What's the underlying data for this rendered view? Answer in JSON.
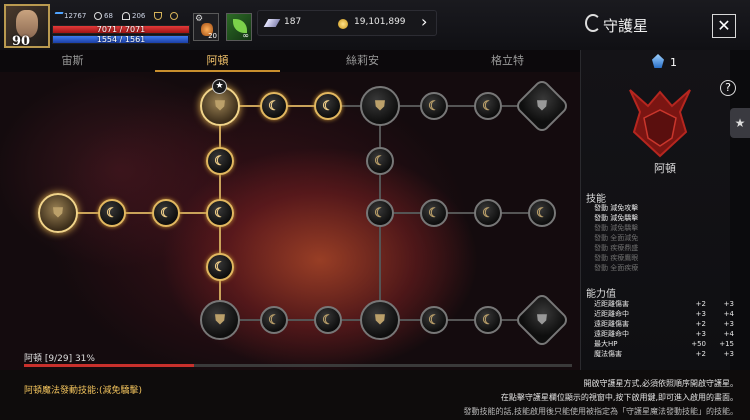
{
  "player": {
    "level": "90",
    "stat_a": "12767",
    "stat_b": "68",
    "stat_c": "206",
    "hp": "7071 / 7071",
    "mp": "1554 / 1561",
    "hp_fraction": 1.0,
    "mp_fraction": 0.9955
  },
  "top_items": {
    "potion_count": "20",
    "elixir_label": "∞"
  },
  "currency": {
    "gems": "187",
    "gold": "19,101,899",
    "arrow": "›"
  },
  "header": {
    "title": "守護星",
    "close": "✕"
  },
  "tabs": [
    {
      "label": "宙斯",
      "active": false
    },
    {
      "label": "阿頓",
      "active": true
    },
    {
      "label": "絲莉安",
      "active": false
    },
    {
      "label": "格立特",
      "active": false
    }
  ],
  "map": {
    "glyph_small": "☾",
    "glyph_big": "⛊",
    "star": "★"
  },
  "progress": {
    "label": "阿頓 [9/29] 31%",
    "fraction": 0.31
  },
  "panel": {
    "gem_count": "1",
    "crest_name": "阿頓",
    "help": "?",
    "side_tab": "★",
    "skills_title": "技能",
    "skills": [
      {
        "text": "發動 減免攻擊",
        "active": true
      },
      {
        "text": "發動 減免驕擊",
        "active": true
      },
      {
        "text": "發動 減免驕擊",
        "active": false
      },
      {
        "text": "發動 全面減免",
        "active": false
      },
      {
        "text": "發動 疾療鼎盛",
        "active": false
      },
      {
        "text": "發動 疾療鷹眼",
        "active": false
      },
      {
        "text": "發動 全面疾療",
        "active": false
      }
    ],
    "stats_title": "能力值",
    "stats": [
      {
        "name": "近距離傷害",
        "v1": "+2",
        "v2": "+3"
      },
      {
        "name": "近距離命中",
        "v1": "+3",
        "v2": "+4"
      },
      {
        "name": "遠距離傷害",
        "v1": "+2",
        "v2": "+3"
      },
      {
        "name": "遠距離命中",
        "v1": "+3",
        "v2": "+4"
      },
      {
        "name": "最大HP",
        "v1": "+50",
        "v2": "+15"
      },
      {
        "name": "魔法傷害",
        "v1": "+2",
        "v2": "+3"
      }
    ]
  },
  "footer": {
    "magic_skill": "阿頓魔法發動技能:(減免驕擊)",
    "note1": "開啟守護星方式,必須依照順序開啟守護星。",
    "note2": "在點擊守護星欄位顯示的視窗中,按下啟用鍵,即可進入啟用的畫面。",
    "note3": "發動技能的話,技能啟用後只能使用被指定為「守護星魔法發動技能」的技能。"
  },
  "colors": {
    "accent": "#f0c25c",
    "hp": "#d62b2b",
    "mp": "#2e5fd8",
    "progress": "#c9302c"
  }
}
